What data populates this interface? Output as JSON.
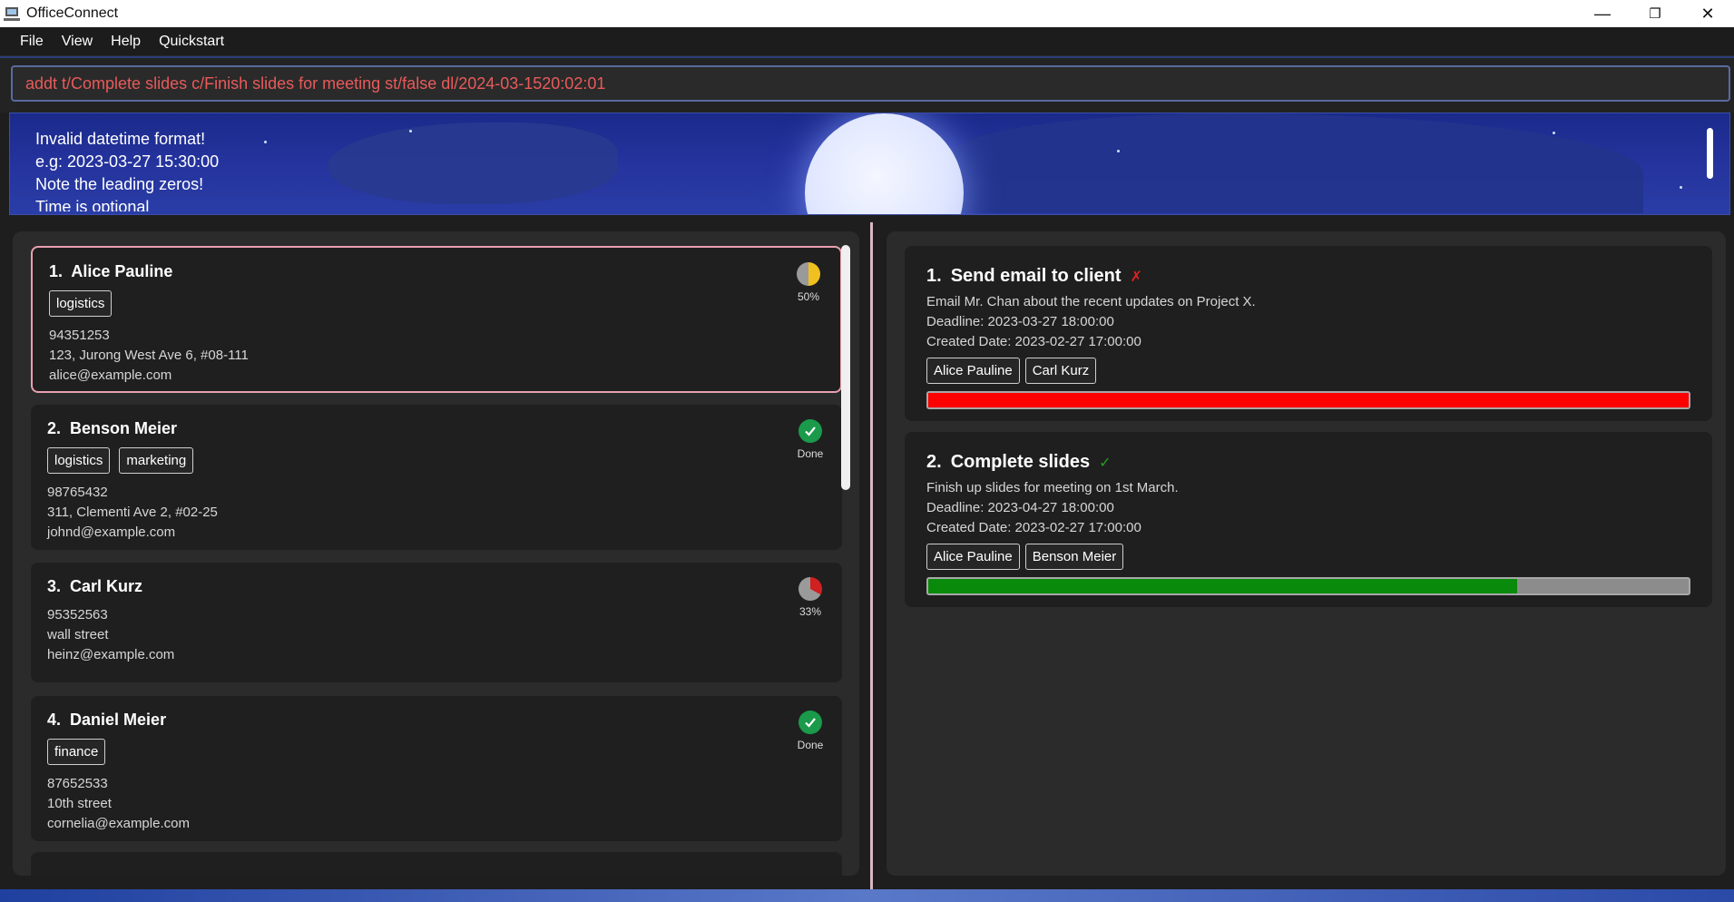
{
  "window": {
    "title": "OfficeConnect",
    "minimize_glyph": "—",
    "restore_glyph": "❐",
    "close_glyph": "✕"
  },
  "menu": {
    "items": [
      "File",
      "View",
      "Help",
      "Quickstart"
    ]
  },
  "command": {
    "value": "addt t/Complete slides c/Finish slides for meeting st/false dl/2024-03-1520:02:01"
  },
  "result": {
    "text": "Invalid datetime format!\ne.g: 2023-03-27 15:30:00\nNote the leading zeros!\nTime is optional"
  },
  "persons": [
    {
      "index": "1.",
      "name": "Alice Pauline",
      "tags": [
        "logistics"
      ],
      "phone": "94351253",
      "address": "123, Jurong West Ave 6, #08-111",
      "email": "alice@example.com",
      "status": "50%",
      "status_kind": "partial",
      "progress": 0.5,
      "color": "#f0c020"
    },
    {
      "index": "2.",
      "name": "Benson Meier",
      "tags": [
        "logistics",
        "marketing"
      ],
      "phone": "98765432",
      "address": "311, Clementi Ave 2, #02-25",
      "email": "johnd@example.com",
      "status": "Done",
      "status_kind": "done",
      "progress": 1,
      "color": "#1a9a4a"
    },
    {
      "index": "3.",
      "name": "Carl Kurz",
      "tags": [],
      "phone": "95352563",
      "address": "wall street",
      "email": "heinz@example.com",
      "status": "33%",
      "status_kind": "partial",
      "progress": 0.33,
      "color": "#d02020"
    },
    {
      "index": "4.",
      "name": "Daniel Meier",
      "tags": [
        "finance"
      ],
      "phone": "87652533",
      "address": "10th street",
      "email": "cornelia@example.com",
      "status": "Done",
      "status_kind": "done",
      "progress": 1,
      "color": "#1a9a4a"
    }
  ],
  "tasks": [
    {
      "index": "1.",
      "title": "Send email to client",
      "mark": "✗",
      "mark_color": "#e02020",
      "description": "Email Mr. Chan about the recent updates on Project X.",
      "deadline": "Deadline: 2023-03-27 18:00:00",
      "created": "Created Date: 2023-02-27 17:00:00",
      "assignees": [
        "Alice Pauline",
        "Carl Kurz"
      ],
      "progress": 1.0,
      "progress_color": "#ff0000"
    },
    {
      "index": "2.",
      "title": "Complete slides",
      "mark": "✓",
      "mark_color": "#22a022",
      "description": "Finish up slides for meeting on 1st March.",
      "deadline": "Deadline: 2023-04-27 18:00:00",
      "created": "Created Date: 2023-02-27 17:00:00",
      "assignees": [
        "Alice Pauline",
        "Benson Meier"
      ],
      "progress": 0.775,
      "progress_color": "#0a8a0a"
    }
  ]
}
